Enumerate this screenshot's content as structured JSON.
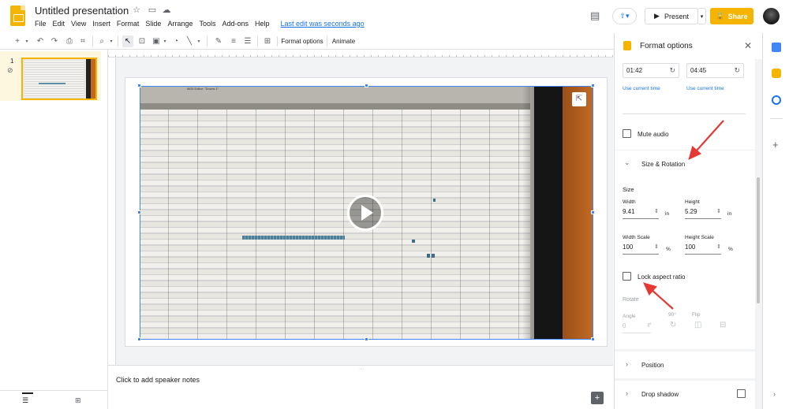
{
  "header": {
    "title": "Untitled presentation",
    "menus": [
      "File",
      "Edit",
      "View",
      "Insert",
      "Format",
      "Slide",
      "Arrange",
      "Tools",
      "Add-ons",
      "Help"
    ],
    "last_edit": "Last edit was seconds ago",
    "present_label": "Present",
    "share_label": "Share"
  },
  "toolbar": {
    "format_options_label": "Format options",
    "animate_label": "Animate"
  },
  "filmstrip": {
    "slide_number": "1"
  },
  "notes": {
    "placeholder": "Click to add speaker notes"
  },
  "panel": {
    "title": "Format options",
    "start_time": "01:42",
    "end_time": "04:45",
    "use_current_time_1": "Use current time",
    "use_current_time_2": "Use current time",
    "mute_audio_label": "Mute audio",
    "size_rotation_title": "Size & Rotation",
    "size_label": "Size",
    "width_label": "Width",
    "width_value": "9.41",
    "width_unit": "in",
    "height_label": "Height",
    "height_value": "5.29",
    "height_unit": "in",
    "width_scale_label": "Width Scale",
    "width_scale_value": "100",
    "width_scale_unit": "%",
    "height_scale_label": "Height Scale",
    "height_scale_value": "100",
    "height_scale_unit": "%",
    "lock_aspect_label": "Lock aspect ratio",
    "rotate_label": "Rotate",
    "angle_label": "Angle",
    "angle_value": "0",
    "angle_unit": "°",
    "rotate_90_label": "90°",
    "flip_label": "Flip",
    "position_title": "Position",
    "drop_shadow_title": "Drop shadow"
  },
  "video": {
    "window_title": "MIDI Editor: \"Drums 1\""
  },
  "colors": {
    "accent": "#f4b400",
    "link": "#1a73e8",
    "annotation_arrow": "#e53935",
    "selection": "#4285f4"
  }
}
